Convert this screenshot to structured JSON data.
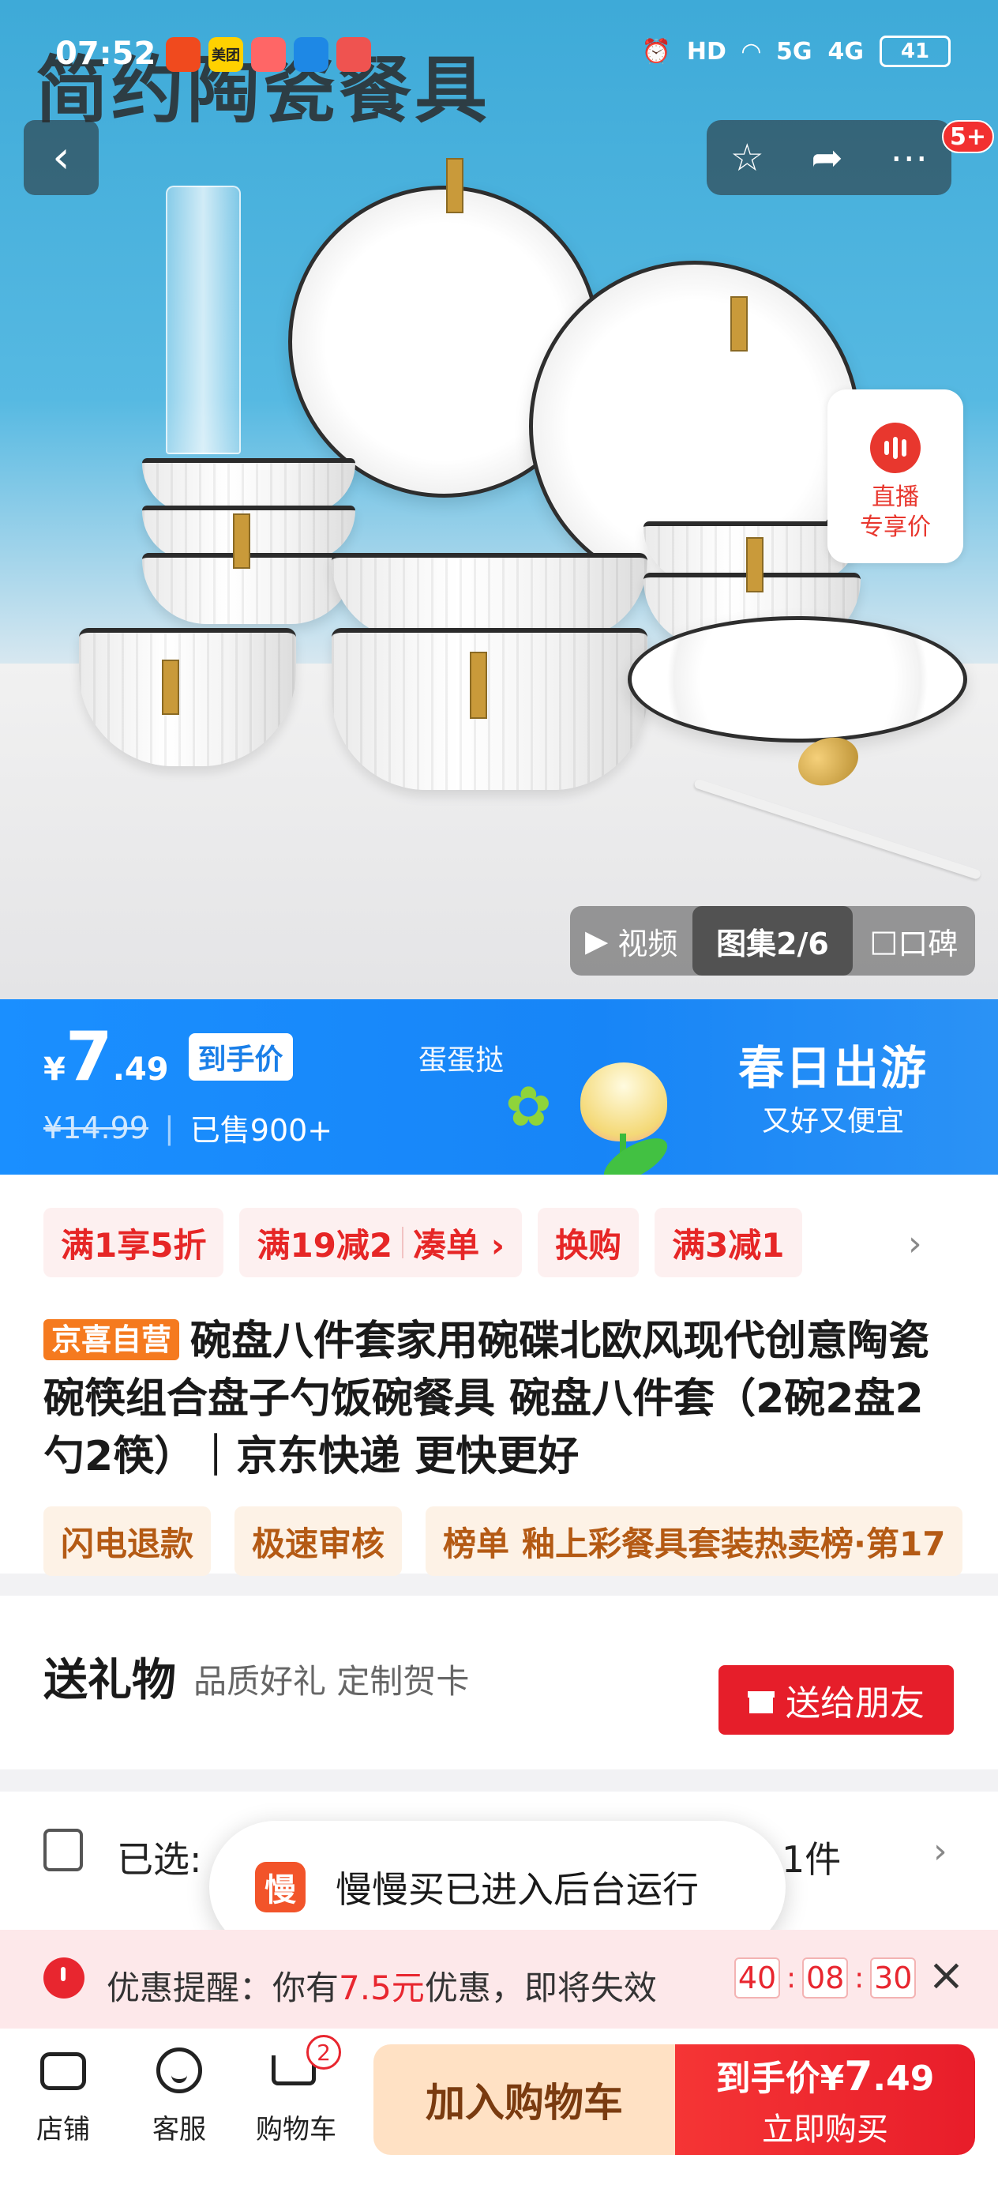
{
  "status_bar": {
    "time": "07:52",
    "apps": [
      "美团",
      "路"
    ],
    "signal": "5G",
    "signal2": "4G",
    "hd": "HD",
    "battery": "41"
  },
  "hero": {
    "banner_text": "简约陶瓷餐具",
    "badge": "5+",
    "live": {
      "line1": "直播",
      "line2": "专享价"
    },
    "media": {
      "video": "视频",
      "gallery": "图集2/6",
      "reviews": "口碑"
    }
  },
  "price": {
    "currency": "¥",
    "integer": "7",
    "decimal": ".49",
    "tag": "到手价",
    "original": "¥14.99",
    "sold": "已售900+",
    "egg": "蛋蛋挞",
    "campaign_title": "春日出游",
    "campaign_sub": "又好又便宜"
  },
  "promos": [
    {
      "label": "满1享5折"
    },
    {
      "label": "满19减2",
      "extra": "凑单 ›"
    },
    {
      "label": "换购"
    },
    {
      "label": "满3减1"
    }
  ],
  "product": {
    "store_tag": "京喜自营",
    "title": "碗盘八件套家用碗碟北欧风现代创意陶瓷碗筷组合盘子勺饭碗餐具 碗盘八件套（2碗2盘2勺2筷）｜京东快递 更快更好"
  },
  "features": [
    {
      "label": "闪电退款"
    },
    {
      "label": "极速审核"
    },
    {
      "label": "榜单",
      "detail": "釉上彩餐具套装热卖榜·第17"
    }
  ],
  "gift": {
    "title": "送礼物",
    "subtitle": "品质好礼 定制贺卡",
    "button": "送给朋友"
  },
  "selection": {
    "label": "已选:",
    "count": "1件"
  },
  "toast": {
    "icon_char": "慢",
    "text": "慢慢买已进入后台运行"
  },
  "reminder": {
    "prefix": "优惠提醒：你有",
    "amount": "7.5元",
    "suffix": "优惠，即将失效",
    "hours": "40",
    "minutes": "08",
    "seconds": "30"
  },
  "bottom_bar": {
    "store": "店铺",
    "service": "客服",
    "cart": "购物车",
    "cart_count": "2",
    "add_to_cart": "加入购物车",
    "buy_price_label": "到手价¥",
    "buy_price_int": "7",
    "buy_price_dec": ".49",
    "buy_now": "立即购买"
  },
  "colors": {
    "accent_blue": "#1a8fff",
    "accent_red": "#e61e2a",
    "promo_bg": "#fdf0f0",
    "feature_bg": "#fdf2e6"
  }
}
